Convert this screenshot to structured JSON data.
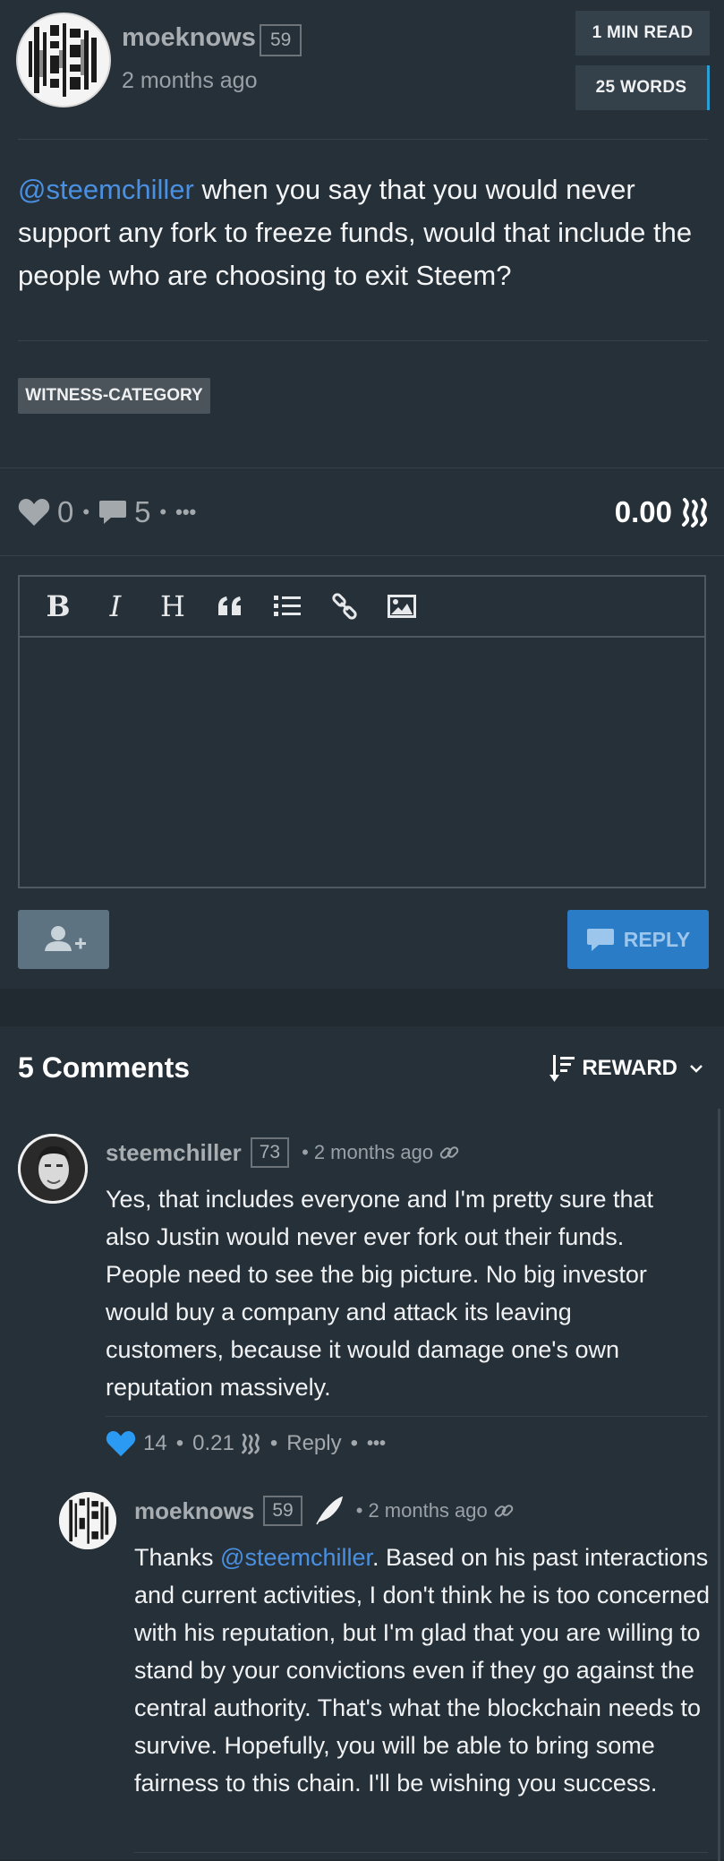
{
  "post": {
    "author": "moeknows",
    "reputation": "59",
    "time": "2 months ago",
    "read_time": "1 MIN READ",
    "word_count": "25 WORDS",
    "mention": "@steemchiller",
    "body": " when you say that you would never support any fork to freeze funds, would that include the people who are choosing to exit Steem?",
    "tag": "WITNESS-CATEGORY",
    "votes": "0",
    "comments_count": "5",
    "more": "•••",
    "payout": "0.00"
  },
  "editor": {
    "toolbar": {
      "bold": "B",
      "italic": "I",
      "heading": "H"
    },
    "reply_label": "REPLY"
  },
  "comments_section": {
    "title": "5 Comments",
    "sort_label": "REWARD",
    "comments": [
      {
        "author": "steemchiller",
        "reputation": "73",
        "time": "2 months ago",
        "body": "Yes, that includes everyone and I'm pretty sure that also Justin would never ever fork out their funds. People need to see the big picture. No big investor would buy a company and attack its leaving customers, because it would damage one's own reputation massively.",
        "votes": "14",
        "payout": "0.21",
        "reply_label": "Reply",
        "more": "•••"
      },
      {
        "author": "moeknows",
        "reputation": "59",
        "time": "2 months ago",
        "body_prefix": "Thanks ",
        "mention": "@steemchiller",
        "body": ". Based on his past interactions and current activities, I don't think he is too concerned with his reputation, but I'm glad that you are willing to stand by your convictions even if they go against the central authority. That's what the blockchain needs to survive. Hopefully, you will be able to bring some fairness to this chain. I'll be wishing you success."
      }
    ]
  },
  "colors": {
    "accent": "#2a7cc7",
    "link": "#4a90e2",
    "background": "#263038",
    "liked": "#2b9af3"
  }
}
